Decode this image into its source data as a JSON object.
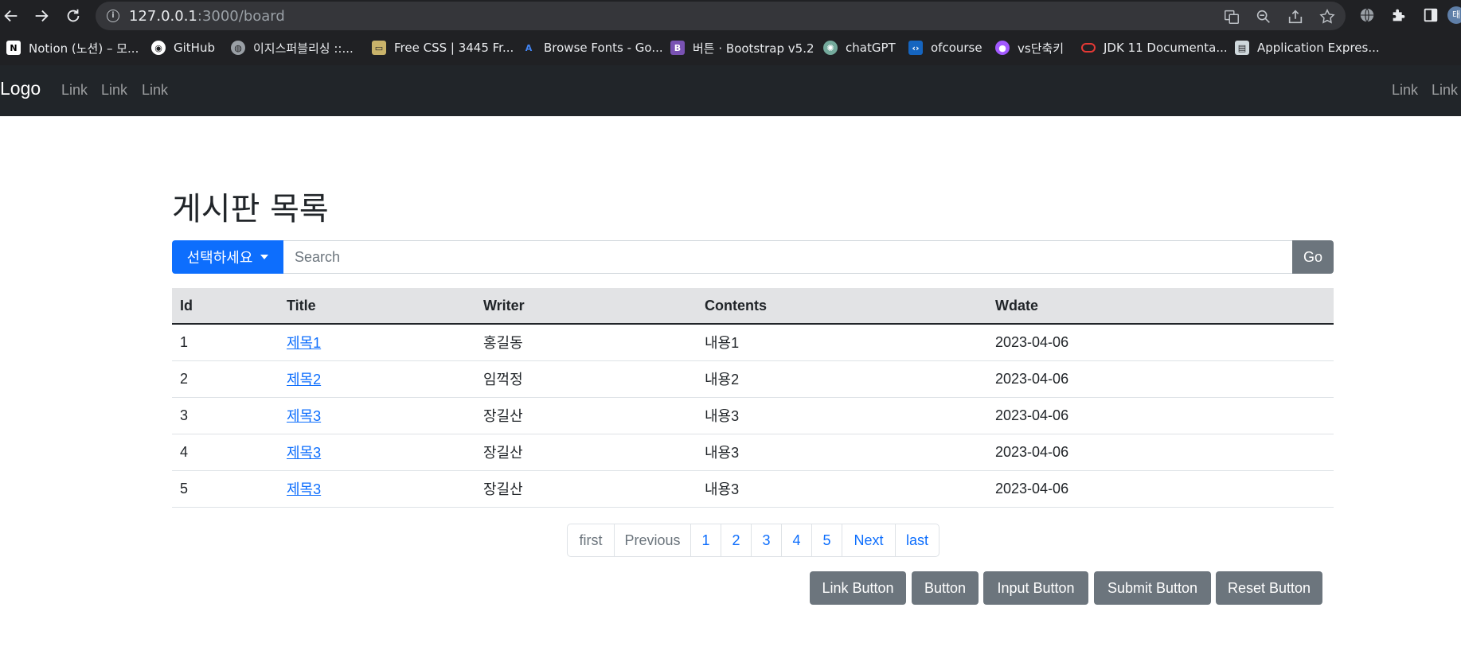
{
  "browser": {
    "url_host": "127.0.0.1",
    "url_path": ":3000/board",
    "info_icon": "i",
    "bookmarks": [
      {
        "label": "Notion (노션) – 모...",
        "icon": "notion-icon",
        "color": "#ffffff"
      },
      {
        "label": "GitHub",
        "icon": "github-icon",
        "color": "#ffffff"
      },
      {
        "label": "이지스퍼블리싱 ::...",
        "icon": "globe-icon",
        "color": "#9aa0a6"
      },
      {
        "label": "Free CSS | 3445 Fr...",
        "icon": "freecss-icon",
        "color": "#c9b36a"
      },
      {
        "label": "Browse Fonts - Go...",
        "icon": "google-fonts-icon",
        "color": "#4285f4"
      },
      {
        "label": "버튼 · Bootstrap v5.2",
        "icon": "bootstrap-icon",
        "color": "#7952b3"
      },
      {
        "label": "chatGPT",
        "icon": "chatgpt-icon",
        "color": "#74aa9c"
      },
      {
        "label": "ofcourse",
        "icon": "code-icon",
        "color": "#1565c0"
      },
      {
        "label": "vs단축키",
        "icon": "vs-icon",
        "color": "#a259ff"
      },
      {
        "label": "JDK 11 Documenta...",
        "icon": "oracle-icon",
        "color": "#e53935"
      },
      {
        "label": "Application Expres...",
        "icon": "page-icon",
        "color": "#cfd8dc"
      }
    ],
    "profile_initial": "태"
  },
  "navbar": {
    "brand": "Logo",
    "left_links": [
      "Link",
      "Link",
      "Link"
    ],
    "right_links": [
      "Link",
      "Link"
    ]
  },
  "page": {
    "title": "게시판 목록"
  },
  "search": {
    "select_label": "선택하세요",
    "placeholder": "Search",
    "go_label": "Go"
  },
  "table": {
    "headers": [
      "Id",
      "Title",
      "Writer",
      "Contents",
      "Wdate"
    ],
    "rows": [
      {
        "id": "1",
        "title": "제목1",
        "writer": "홍길동",
        "contents": "내용1",
        "wdate": "2023-04-06"
      },
      {
        "id": "2",
        "title": "제목2",
        "writer": "임꺽정",
        "contents": "내용2",
        "wdate": "2023-04-06"
      },
      {
        "id": "3",
        "title": "제목3",
        "writer": "장길산",
        "contents": "내용3",
        "wdate": "2023-04-06"
      },
      {
        "id": "4",
        "title": "제목3",
        "writer": "장길산",
        "contents": "내용3",
        "wdate": "2023-04-06"
      },
      {
        "id": "5",
        "title": "제목3",
        "writer": "장길산",
        "contents": "내용3",
        "wdate": "2023-04-06"
      }
    ]
  },
  "pagination": {
    "first": "first",
    "previous": "Previous",
    "pages": [
      "1",
      "2",
      "3",
      "4",
      "5"
    ],
    "next": "Next",
    "last": "last"
  },
  "buttons": {
    "link_button": "Link Button",
    "button": "Button",
    "input_button": "Input Button",
    "submit_button": "Submit Button",
    "reset_button": "Reset Button"
  }
}
